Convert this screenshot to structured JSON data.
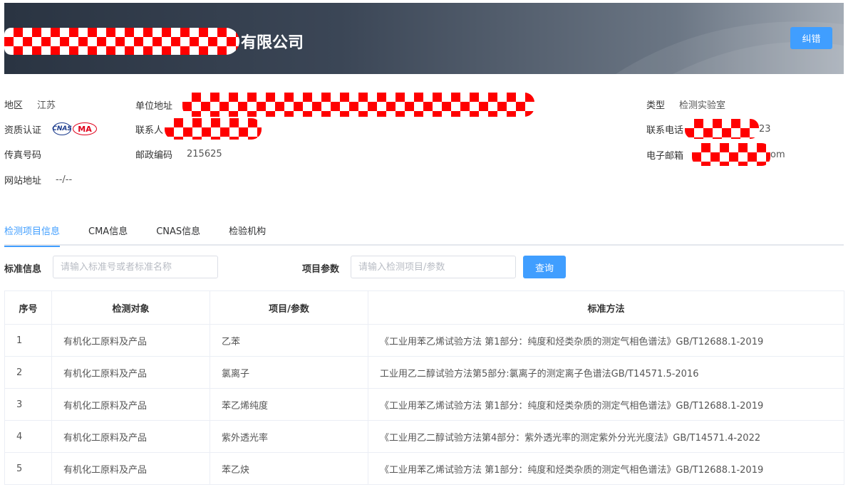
{
  "header": {
    "company_suffix": "有限公司",
    "correct_button": "纠错"
  },
  "info": {
    "region_label": "地区",
    "region_value": "江苏",
    "address_label": "单位地址",
    "type_label": "类型",
    "type_value": "检测实验室",
    "qualification_label": "资质认证",
    "cert_cnas": "CNAS",
    "cert_ma": "MA",
    "contact_label": "联系人",
    "phone_label": "联系电话",
    "phone_tail": "23",
    "fax_label": "传真号码",
    "postcode_label": "邮政编码",
    "postcode_value": "215625",
    "email_label": "电子邮箱",
    "email_tail": "om",
    "website_label": "网站地址",
    "website_value": "--/--"
  },
  "tabs": [
    {
      "label": "检测项目信息",
      "active": true
    },
    {
      "label": "CMA信息",
      "active": false
    },
    {
      "label": "CNAS信息",
      "active": false
    },
    {
      "label": "检验机构",
      "active": false
    }
  ],
  "search": {
    "standard_label": "标准信息",
    "standard_placeholder": "请输入标准号或者标准名称",
    "param_label": "项目参数",
    "param_placeholder": "请输入检测项目/参数",
    "query_button": "查询"
  },
  "table": {
    "headers": [
      "序号",
      "检测对象",
      "项目/参数",
      "标准方法"
    ],
    "rows": [
      [
        "1",
        "有机化工原料及产品",
        "乙苯",
        "《工业用苯乙烯试验方法 第1部分：纯度和烃类杂质的测定气相色谱法》GB/T12688.1-2019"
      ],
      [
        "2",
        "有机化工原料及产品",
        "氯离子",
        "工业用乙二醇试验方法第5部分:氯离子的测定离子色谱法GB/T14571.5-2016"
      ],
      [
        "3",
        "有机化工原料及产品",
        "苯乙烯纯度",
        "《工业用苯乙烯试验方法 第1部分：纯度和烃类杂质的测定气相色谱法》GB/T12688.1-2019"
      ],
      [
        "4",
        "有机化工原料及产品",
        "紫外透光率",
        "《工业用乙二醇试验方法第4部分：紫外透光率的测定紫外分光光度法》GB/T14571.4-2022"
      ],
      [
        "5",
        "有机化工原料及产品",
        "苯乙炔",
        "《工业用苯乙烯试验方法 第1部分：纯度和烃类杂质的测定气相色谱法》GB/T12688.1-2019"
      ]
    ]
  },
  "colors": {
    "accent": "#409eff",
    "redaction": "#ff0000"
  }
}
